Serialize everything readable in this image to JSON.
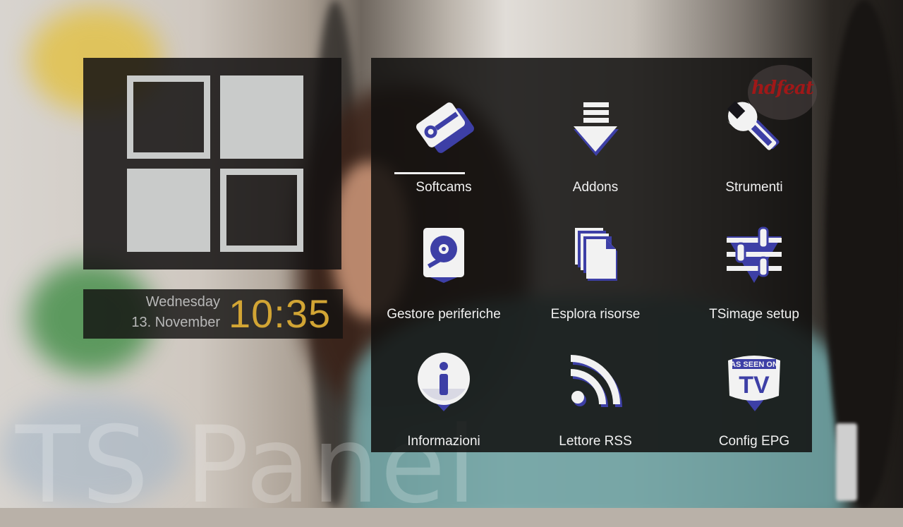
{
  "app": {
    "title": "TS Panel"
  },
  "clock": {
    "weekday": "Wednesday",
    "date": "13. November",
    "time": "10:35"
  },
  "badge": {
    "text": "hdfeat"
  },
  "menu": {
    "selected_index": 0,
    "items": [
      {
        "label": "Softcams",
        "icon": "softcam-key-icon"
      },
      {
        "label": "Addons",
        "icon": "download-arrow-icon"
      },
      {
        "label": "Strumenti",
        "icon": "wrench-icon"
      },
      {
        "label": "Gestore periferiche",
        "icon": "hard-disk-icon"
      },
      {
        "label": "Esplora risorse",
        "icon": "files-icon"
      },
      {
        "label": "TSimage setup",
        "icon": "sliders-icon"
      },
      {
        "label": "Informazioni",
        "icon": "info-icon"
      },
      {
        "label": "Lettore RSS",
        "icon": "rss-icon"
      },
      {
        "label": "Config EPG",
        "icon": "as-seen-on-tv-icon"
      }
    ]
  },
  "colors": {
    "icon_blue": "#3d3fa6",
    "icon_white": "#f2f2f2",
    "clock_time": "#d2a534",
    "logo_squares": "#c9cbca"
  },
  "tv_icon_text": {
    "line1": "AS SEEN ON",
    "line2": "TV"
  }
}
